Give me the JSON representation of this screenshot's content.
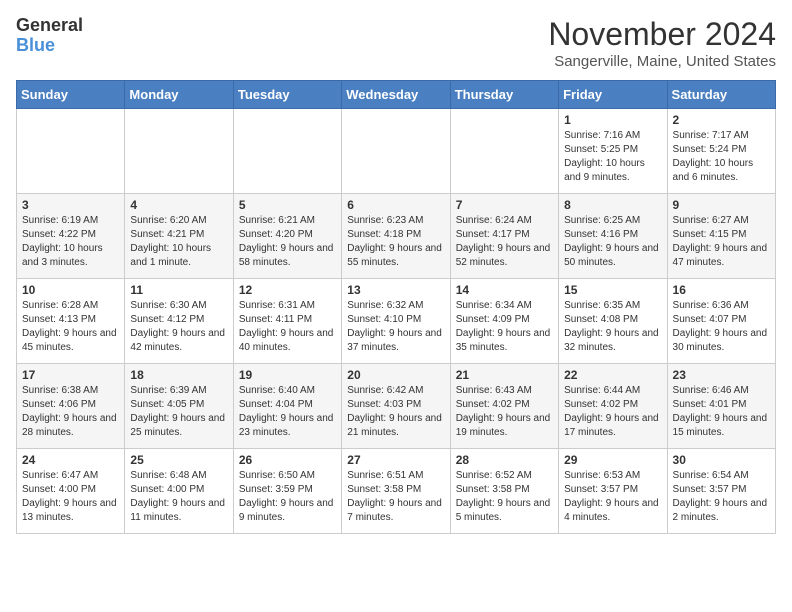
{
  "logo": {
    "line1": "General",
    "line2": "Blue"
  },
  "title": "November 2024",
  "location": "Sangerville, Maine, United States",
  "headers": [
    "Sunday",
    "Monday",
    "Tuesday",
    "Wednesday",
    "Thursday",
    "Friday",
    "Saturday"
  ],
  "weeks": [
    [
      {
        "day": "",
        "sunrise": "",
        "sunset": "",
        "daylight": ""
      },
      {
        "day": "",
        "sunrise": "",
        "sunset": "",
        "daylight": ""
      },
      {
        "day": "",
        "sunrise": "",
        "sunset": "",
        "daylight": ""
      },
      {
        "day": "",
        "sunrise": "",
        "sunset": "",
        "daylight": ""
      },
      {
        "day": "",
        "sunrise": "",
        "sunset": "",
        "daylight": ""
      },
      {
        "day": "1",
        "sunrise": "Sunrise: 7:16 AM",
        "sunset": "Sunset: 5:25 PM",
        "daylight": "Daylight: 10 hours and 9 minutes."
      },
      {
        "day": "2",
        "sunrise": "Sunrise: 7:17 AM",
        "sunset": "Sunset: 5:24 PM",
        "daylight": "Daylight: 10 hours and 6 minutes."
      }
    ],
    [
      {
        "day": "3",
        "sunrise": "Sunrise: 6:19 AM",
        "sunset": "Sunset: 4:22 PM",
        "daylight": "Daylight: 10 hours and 3 minutes."
      },
      {
        "day": "4",
        "sunrise": "Sunrise: 6:20 AM",
        "sunset": "Sunset: 4:21 PM",
        "daylight": "Daylight: 10 hours and 1 minute."
      },
      {
        "day": "5",
        "sunrise": "Sunrise: 6:21 AM",
        "sunset": "Sunset: 4:20 PM",
        "daylight": "Daylight: 9 hours and 58 minutes."
      },
      {
        "day": "6",
        "sunrise": "Sunrise: 6:23 AM",
        "sunset": "Sunset: 4:18 PM",
        "daylight": "Daylight: 9 hours and 55 minutes."
      },
      {
        "day": "7",
        "sunrise": "Sunrise: 6:24 AM",
        "sunset": "Sunset: 4:17 PM",
        "daylight": "Daylight: 9 hours and 52 minutes."
      },
      {
        "day": "8",
        "sunrise": "Sunrise: 6:25 AM",
        "sunset": "Sunset: 4:16 PM",
        "daylight": "Daylight: 9 hours and 50 minutes."
      },
      {
        "day": "9",
        "sunrise": "Sunrise: 6:27 AM",
        "sunset": "Sunset: 4:15 PM",
        "daylight": "Daylight: 9 hours and 47 minutes."
      }
    ],
    [
      {
        "day": "10",
        "sunrise": "Sunrise: 6:28 AM",
        "sunset": "Sunset: 4:13 PM",
        "daylight": "Daylight: 9 hours and 45 minutes."
      },
      {
        "day": "11",
        "sunrise": "Sunrise: 6:30 AM",
        "sunset": "Sunset: 4:12 PM",
        "daylight": "Daylight: 9 hours and 42 minutes."
      },
      {
        "day": "12",
        "sunrise": "Sunrise: 6:31 AM",
        "sunset": "Sunset: 4:11 PM",
        "daylight": "Daylight: 9 hours and 40 minutes."
      },
      {
        "day": "13",
        "sunrise": "Sunrise: 6:32 AM",
        "sunset": "Sunset: 4:10 PM",
        "daylight": "Daylight: 9 hours and 37 minutes."
      },
      {
        "day": "14",
        "sunrise": "Sunrise: 6:34 AM",
        "sunset": "Sunset: 4:09 PM",
        "daylight": "Daylight: 9 hours and 35 minutes."
      },
      {
        "day": "15",
        "sunrise": "Sunrise: 6:35 AM",
        "sunset": "Sunset: 4:08 PM",
        "daylight": "Daylight: 9 hours and 32 minutes."
      },
      {
        "day": "16",
        "sunrise": "Sunrise: 6:36 AM",
        "sunset": "Sunset: 4:07 PM",
        "daylight": "Daylight: 9 hours and 30 minutes."
      }
    ],
    [
      {
        "day": "17",
        "sunrise": "Sunrise: 6:38 AM",
        "sunset": "Sunset: 4:06 PM",
        "daylight": "Daylight: 9 hours and 28 minutes."
      },
      {
        "day": "18",
        "sunrise": "Sunrise: 6:39 AM",
        "sunset": "Sunset: 4:05 PM",
        "daylight": "Daylight: 9 hours and 25 minutes."
      },
      {
        "day": "19",
        "sunrise": "Sunrise: 6:40 AM",
        "sunset": "Sunset: 4:04 PM",
        "daylight": "Daylight: 9 hours and 23 minutes."
      },
      {
        "day": "20",
        "sunrise": "Sunrise: 6:42 AM",
        "sunset": "Sunset: 4:03 PM",
        "daylight": "Daylight: 9 hours and 21 minutes."
      },
      {
        "day": "21",
        "sunrise": "Sunrise: 6:43 AM",
        "sunset": "Sunset: 4:02 PM",
        "daylight": "Daylight: 9 hours and 19 minutes."
      },
      {
        "day": "22",
        "sunrise": "Sunrise: 6:44 AM",
        "sunset": "Sunset: 4:02 PM",
        "daylight": "Daylight: 9 hours and 17 minutes."
      },
      {
        "day": "23",
        "sunrise": "Sunrise: 6:46 AM",
        "sunset": "Sunset: 4:01 PM",
        "daylight": "Daylight: 9 hours and 15 minutes."
      }
    ],
    [
      {
        "day": "24",
        "sunrise": "Sunrise: 6:47 AM",
        "sunset": "Sunset: 4:00 PM",
        "daylight": "Daylight: 9 hours and 13 minutes."
      },
      {
        "day": "25",
        "sunrise": "Sunrise: 6:48 AM",
        "sunset": "Sunset: 4:00 PM",
        "daylight": "Daylight: 9 hours and 11 minutes."
      },
      {
        "day": "26",
        "sunrise": "Sunrise: 6:50 AM",
        "sunset": "Sunset: 3:59 PM",
        "daylight": "Daylight: 9 hours and 9 minutes."
      },
      {
        "day": "27",
        "sunrise": "Sunrise: 6:51 AM",
        "sunset": "Sunset: 3:58 PM",
        "daylight": "Daylight: 9 hours and 7 minutes."
      },
      {
        "day": "28",
        "sunrise": "Sunrise: 6:52 AM",
        "sunset": "Sunset: 3:58 PM",
        "daylight": "Daylight: 9 hours and 5 minutes."
      },
      {
        "day": "29",
        "sunrise": "Sunrise: 6:53 AM",
        "sunset": "Sunset: 3:57 PM",
        "daylight": "Daylight: 9 hours and 4 minutes."
      },
      {
        "day": "30",
        "sunrise": "Sunrise: 6:54 AM",
        "sunset": "Sunset: 3:57 PM",
        "daylight": "Daylight: 9 hours and 2 minutes."
      }
    ]
  ]
}
